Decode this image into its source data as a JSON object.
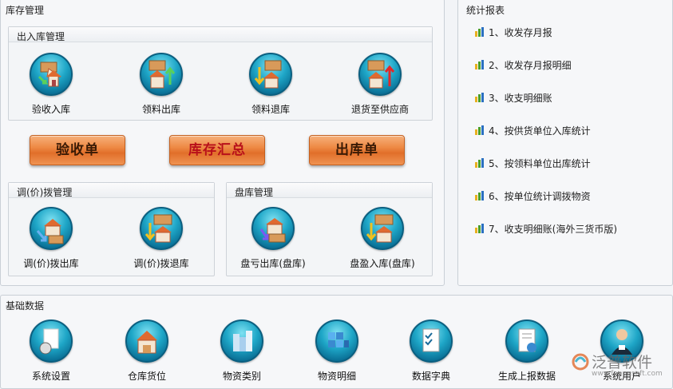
{
  "inventory": {
    "title": "库存管理",
    "inout": {
      "title": "出入库管理",
      "items": [
        {
          "label": "验收入库",
          "icon": "receive-stock-icon"
        },
        {
          "label": "领料出库",
          "icon": "issue-materials-icon"
        },
        {
          "label": "领料退库",
          "icon": "return-materials-icon"
        },
        {
          "label": "退货至供应商",
          "icon": "return-to-supplier-icon"
        }
      ]
    },
    "buttons": {
      "receipt": "验收单",
      "summary": "库存汇总",
      "outbound": "出库单"
    },
    "transfer": {
      "title": "调(价)拨管理",
      "items": [
        {
          "label": "调(价)拨出库",
          "icon": "transfer-out-icon"
        },
        {
          "label": "调(价)拨退库",
          "icon": "transfer-return-icon"
        }
      ]
    },
    "stocktake": {
      "title": "盘库管理",
      "items": [
        {
          "label": "盘亏出库(盘库)",
          "icon": "stock-loss-icon"
        },
        {
          "label": "盘盈入库(盘库)",
          "icon": "stock-gain-icon"
        }
      ]
    }
  },
  "reports": {
    "title": "统计报表",
    "items": [
      "1、收发存月报",
      "2、收发存月报明细",
      "3、收支明细账",
      "4、按供货单位入库统计",
      "5、按领料单位出库统计",
      "6、按单位统计调拨物资",
      "7、收支明细账(海外三货币版)"
    ]
  },
  "basic": {
    "title": "基础数据",
    "items": [
      {
        "label": "系统设置",
        "icon": "system-settings-icon"
      },
      {
        "label": "仓库货位",
        "icon": "warehouse-location-icon"
      },
      {
        "label": "物资类别",
        "icon": "material-category-icon"
      },
      {
        "label": "物资明细",
        "icon": "material-detail-icon"
      },
      {
        "label": "数据字典",
        "icon": "data-dictionary-icon"
      },
      {
        "label": "生成上报数据",
        "icon": "generate-report-data-icon"
      },
      {
        "label": "系统用户",
        "icon": "system-user-icon"
      }
    ]
  },
  "watermark": {
    "brand": "泛普软件",
    "url": "www.fanpusoft.com"
  },
  "colors": {
    "orb": "#1ea6c7",
    "button": "#ee8a45",
    "buttonText": "#3a1a05"
  }
}
